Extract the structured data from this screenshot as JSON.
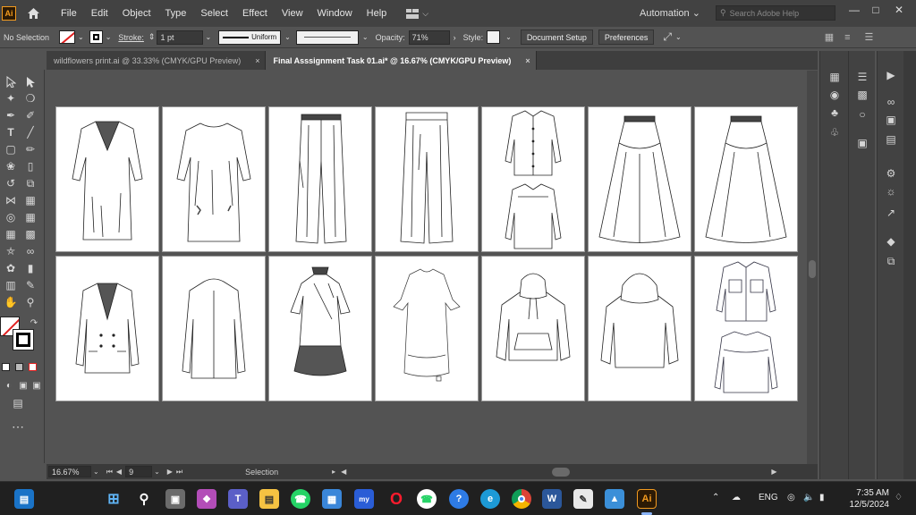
{
  "app": {
    "logo_text": "Ai"
  },
  "menu": {
    "items": [
      "File",
      "Edit",
      "Object",
      "Type",
      "Select",
      "Effect",
      "View",
      "Window",
      "Help"
    ]
  },
  "automation_label": "Automation",
  "search_placeholder": "Search Adobe Help",
  "control_bar": {
    "selection_label": "No Selection",
    "stroke_label": "Stroke:",
    "stroke_value": "1 pt",
    "profile_label": "Uniform",
    "opacity_label": "Opacity:",
    "opacity_value": "71%",
    "style_label": "Style:",
    "document_setup": "Document Setup",
    "preferences": "Preferences"
  },
  "tabs": [
    {
      "label": "wildflowers print.ai @ 33.33% (CMYK/GPU Preview)",
      "active": false
    },
    {
      "label": "Final Asssignment Task 01.ai* @ 16.67% (CMYK/GPU Preview)",
      "active": true
    }
  ],
  "status_bar": {
    "zoom": "16.67%",
    "artboard_number": "9",
    "tool_status": "Selection"
  },
  "taskbar": {
    "apps": [
      "windows-start",
      "search",
      "file-explorer",
      "copilot",
      "teams",
      "folder",
      "whatsapp",
      "store",
      "mydemo",
      "opera",
      "whatsapp-web",
      "qbittorrent",
      "edge",
      "chrome",
      "word",
      "paint",
      "photos",
      "illustrator"
    ],
    "illustrator_label": "Ai",
    "language": "ENG",
    "time": "7:35 AM",
    "date": "12/5/2024"
  },
  "colors": {
    "accent": "#f29a1f",
    "ui_dark": "#424242",
    "ui_mid": "#535353",
    "taskbar": "#202020"
  }
}
